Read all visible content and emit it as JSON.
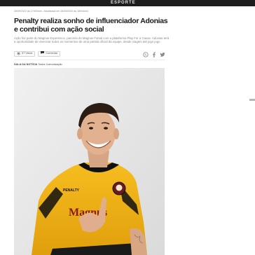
{
  "site": {
    "brand": "ESPORTE"
  },
  "article": {
    "meta": "28/09/2022 às 17h00min - Atualizada em 28/09/2022 às 18h04min",
    "headline": "Penalty realiza sonho de influenciador Adonias e contribui com ação social",
    "lead": "Ação faz parte do Magnus Experience, parceria do Magnus Futsal com a plataforma Play For a Cause. Adonias terá a oportunidade de vivenciar todos os momentos de uma partida oficial da equipe, desde viagem até jogo jogo",
    "credit_label": "SALA DA NOTÍCIA",
    "credit_name": "Tosha Comunicação"
  },
  "actions": {
    "views": "57 Views",
    "comment": "Comentar"
  },
  "share": {
    "icons": [
      "whatsapp-icon",
      "facebook-icon",
      "twitter-icon"
    ]
  },
  "colors": {
    "topbar": "#1e1e1e",
    "jersey": "#f2b416",
    "jersey_black": "#111111"
  }
}
